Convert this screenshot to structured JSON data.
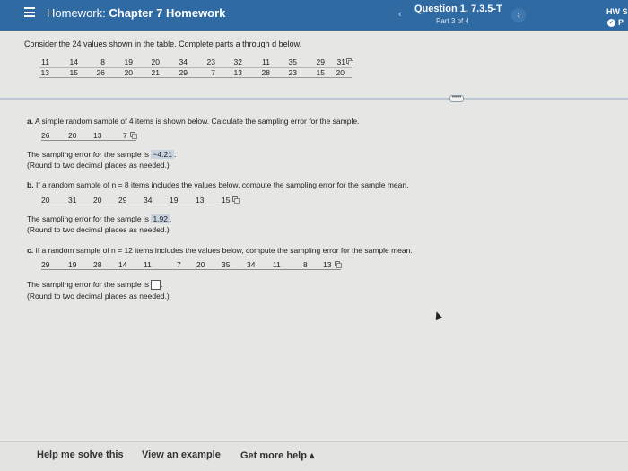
{
  "header": {
    "menu_icon": "hamburger-menu-icon",
    "title_prefix": "Homework:",
    "title": "Chapter 7 Homework",
    "prev_icon": "chevron-left-icon",
    "prev_glyph": "‹",
    "question": "Question 1, 7.3.5-T",
    "part": "Part 3 of 4",
    "next_icon": "chevron-right-icon",
    "next_glyph": "›",
    "hw_score_label": "HW S",
    "hw_icon_glyph": "✓",
    "hw_score_suffix": "P"
  },
  "intro": "Consider the 24 values shown in the table. Complete parts a through d below.",
  "table": {
    "rows": [
      [
        "11",
        "14",
        "8",
        "19",
        "20",
        "34",
        "23",
        "32",
        "11",
        "35",
        "29",
        "31"
      ],
      [
        "13",
        "15",
        "26",
        "20",
        "21",
        "29",
        "7",
        "13",
        "28",
        "23",
        "15",
        "20"
      ]
    ]
  },
  "more_button": "•••••",
  "part_a": {
    "label": "a.",
    "text": "A simple random sample of 4 items is shown below. Calculate the sampling error for the sample.",
    "values": [
      "26",
      "20",
      "13",
      "7"
    ],
    "answer_prefix": "The sampling error for the sample is",
    "answer": "−4.21",
    "answer_suffix": ".",
    "note": "(Round to two decimal places as needed.)"
  },
  "part_b": {
    "label": "b.",
    "text": "If a random sample of n = 8 items includes the values below, compute the sampling error for the sample mean.",
    "values": [
      "20",
      "31",
      "20",
      "29",
      "34",
      "19",
      "13",
      "15"
    ],
    "answer_prefix": "The sampling error for the sample is",
    "answer": "1.92",
    "answer_suffix": ".",
    "note": "(Round to two decimal places as needed.)"
  },
  "part_c": {
    "label": "c.",
    "text": "If a random sample of n = 12 items includes the values below, compute the sampling error for the sample mean.",
    "values": [
      "29",
      "19",
      "28",
      "14",
      "11",
      "7",
      "20",
      "35",
      "34",
      "11",
      "8",
      "13"
    ],
    "answer_prefix": "The sampling error for the sample is",
    "answer": "",
    "answer_suffix": ".",
    "note": "(Round to two decimal places as needed.)"
  },
  "footer": {
    "help": "Help me solve this",
    "example": "View an example",
    "more_help": "Get more help",
    "more_help_icon": "caret-up-icon",
    "more_help_glyph": "▴"
  }
}
